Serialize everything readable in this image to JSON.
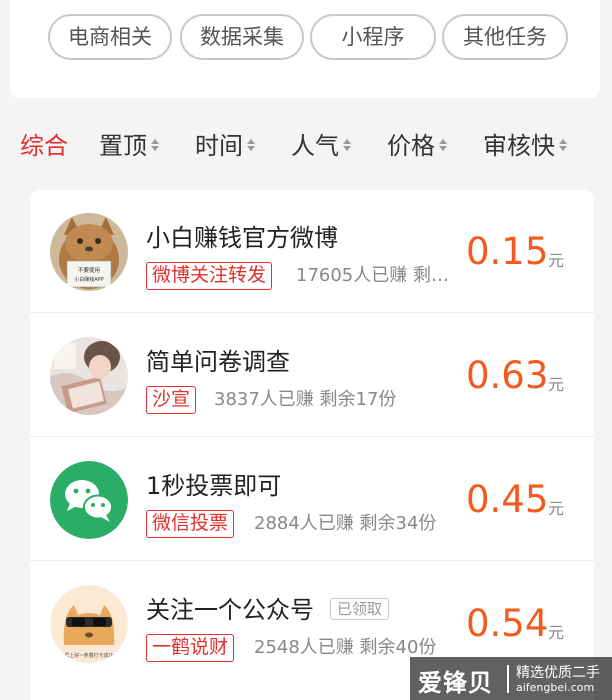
{
  "categories": [
    "电商相关",
    "数据采集",
    "小程序",
    "其他任务"
  ],
  "sort_tabs": [
    {
      "label": "综合",
      "active": true
    },
    {
      "label": "置顶",
      "active": false
    },
    {
      "label": "时间",
      "active": false
    },
    {
      "label": "人气",
      "active": false
    },
    {
      "label": "价格",
      "active": false
    },
    {
      "label": "审核快",
      "active": false
    }
  ],
  "tasks": [
    {
      "title": "小白赚钱官方微博",
      "tag": "微博关注转发",
      "meta": "17605人已赚  剩…",
      "price": "0.15",
      "unit": "元",
      "avatar": "cat-photo"
    },
    {
      "title": "简单问卷调查",
      "tag": "沙宣",
      "meta": "3837人已赚  剩余17份",
      "price": "0.63",
      "unit": "元",
      "avatar": "person-photo"
    },
    {
      "title": "1秒投票即可",
      "tag": "微信投票",
      "meta": "2884人已赚  剩余34份",
      "price": "0.45",
      "unit": "元",
      "avatar": "wechat-logo"
    },
    {
      "title": "关注一个公众号",
      "claimed": "已领取",
      "tag": "一鹤说财",
      "meta": "2548人已赚  剩余40份",
      "price": "0.54",
      "unit": "元",
      "avatar": "cartoon-cat"
    }
  ],
  "avatar_text": {
    "cat_sign": "不要使用 小白赚钱APP",
    "cartoon_caption": "早上好~养着打卡成功"
  },
  "colors": {
    "accent_red": "#e0312d",
    "price_orange": "#f25a1e",
    "wechat_green": "#2aae67"
  },
  "watermark": {
    "brand": "爱锋贝",
    "slogan": "精选优质二手",
    "domain": "aifengbei.com"
  }
}
